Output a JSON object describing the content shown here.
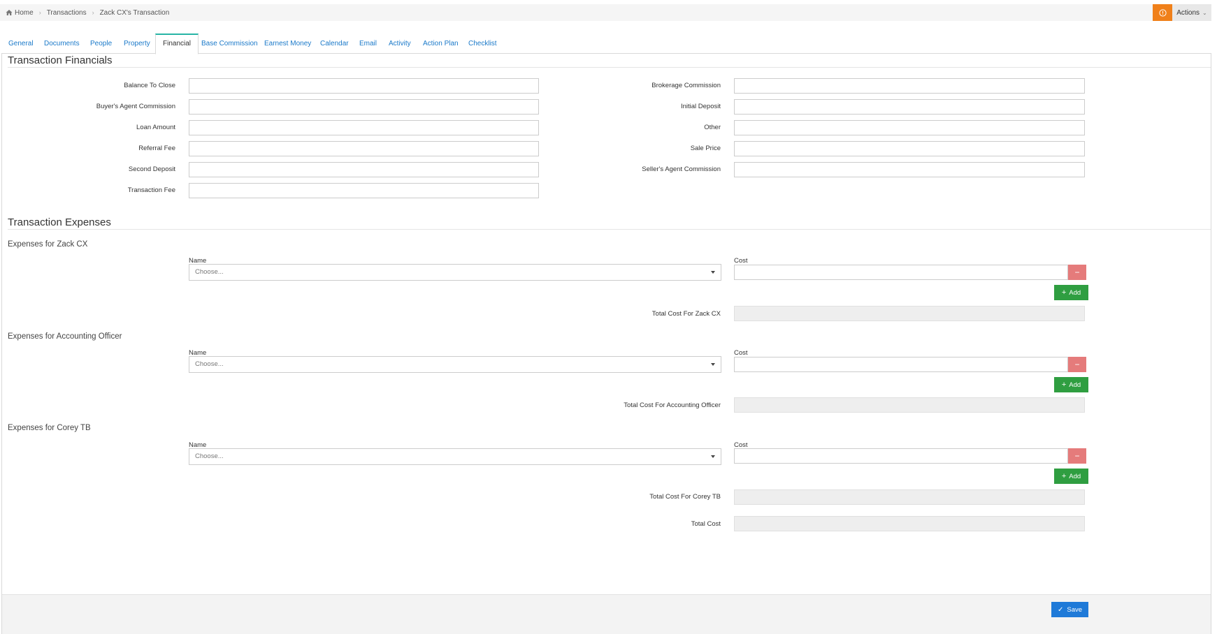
{
  "breadcrumb": {
    "items": [
      "Home",
      "Transactions",
      "Zack CX's Transaction"
    ]
  },
  "header": {
    "info_icon": "info-circle-icon",
    "actions_label": "Actions"
  },
  "tabs": [
    {
      "label": "General"
    },
    {
      "label": "Documents"
    },
    {
      "label": "People"
    },
    {
      "label": "Property"
    },
    {
      "label": "Financial",
      "active": true
    },
    {
      "label": "Base Commission"
    },
    {
      "label": "Earnest Money"
    },
    {
      "label": "Calendar"
    },
    {
      "label": "Email"
    },
    {
      "label": "Activity"
    },
    {
      "label": "Action Plan"
    },
    {
      "label": "Checklist"
    }
  ],
  "financials": {
    "title": "Transaction Financials",
    "left_fields": [
      {
        "label": "Balance To Close",
        "value": ""
      },
      {
        "label": "Buyer's Agent Commission",
        "value": ""
      },
      {
        "label": "Loan Amount",
        "value": ""
      },
      {
        "label": "Referral Fee",
        "value": ""
      },
      {
        "label": "Second Deposit",
        "value": ""
      },
      {
        "label": "Transaction Fee",
        "value": ""
      }
    ],
    "right_fields": [
      {
        "label": "Brokerage Commission",
        "value": ""
      },
      {
        "label": "Initial Deposit",
        "value": ""
      },
      {
        "label": "Other",
        "value": ""
      },
      {
        "label": "Sale Price",
        "value": ""
      },
      {
        "label": "Seller's Agent Commission",
        "value": ""
      }
    ]
  },
  "expenses": {
    "title": "Transaction Expenses",
    "name_label": "Name",
    "cost_label": "Cost",
    "select_placeholder": "Choose...",
    "add_label": "Add",
    "groups": [
      {
        "title": "Expenses for Zack CX",
        "total_label": "Total Cost For Zack CX"
      },
      {
        "title": "Expenses for Accounting Officer",
        "total_label": "Total Cost For Accounting Officer"
      },
      {
        "title": "Expenses for Corey TB",
        "total_label": "Total Cost For Corey TB"
      }
    ],
    "grand_total_label": "Total Cost"
  },
  "footer": {
    "save_label": "Save"
  },
  "colors": {
    "accent_tab": "#27b4a5",
    "link": "#1a79c9",
    "info": "#f0801a",
    "add": "#2f9e41",
    "remove": "#e57b7b",
    "save": "#1f7ad8"
  }
}
